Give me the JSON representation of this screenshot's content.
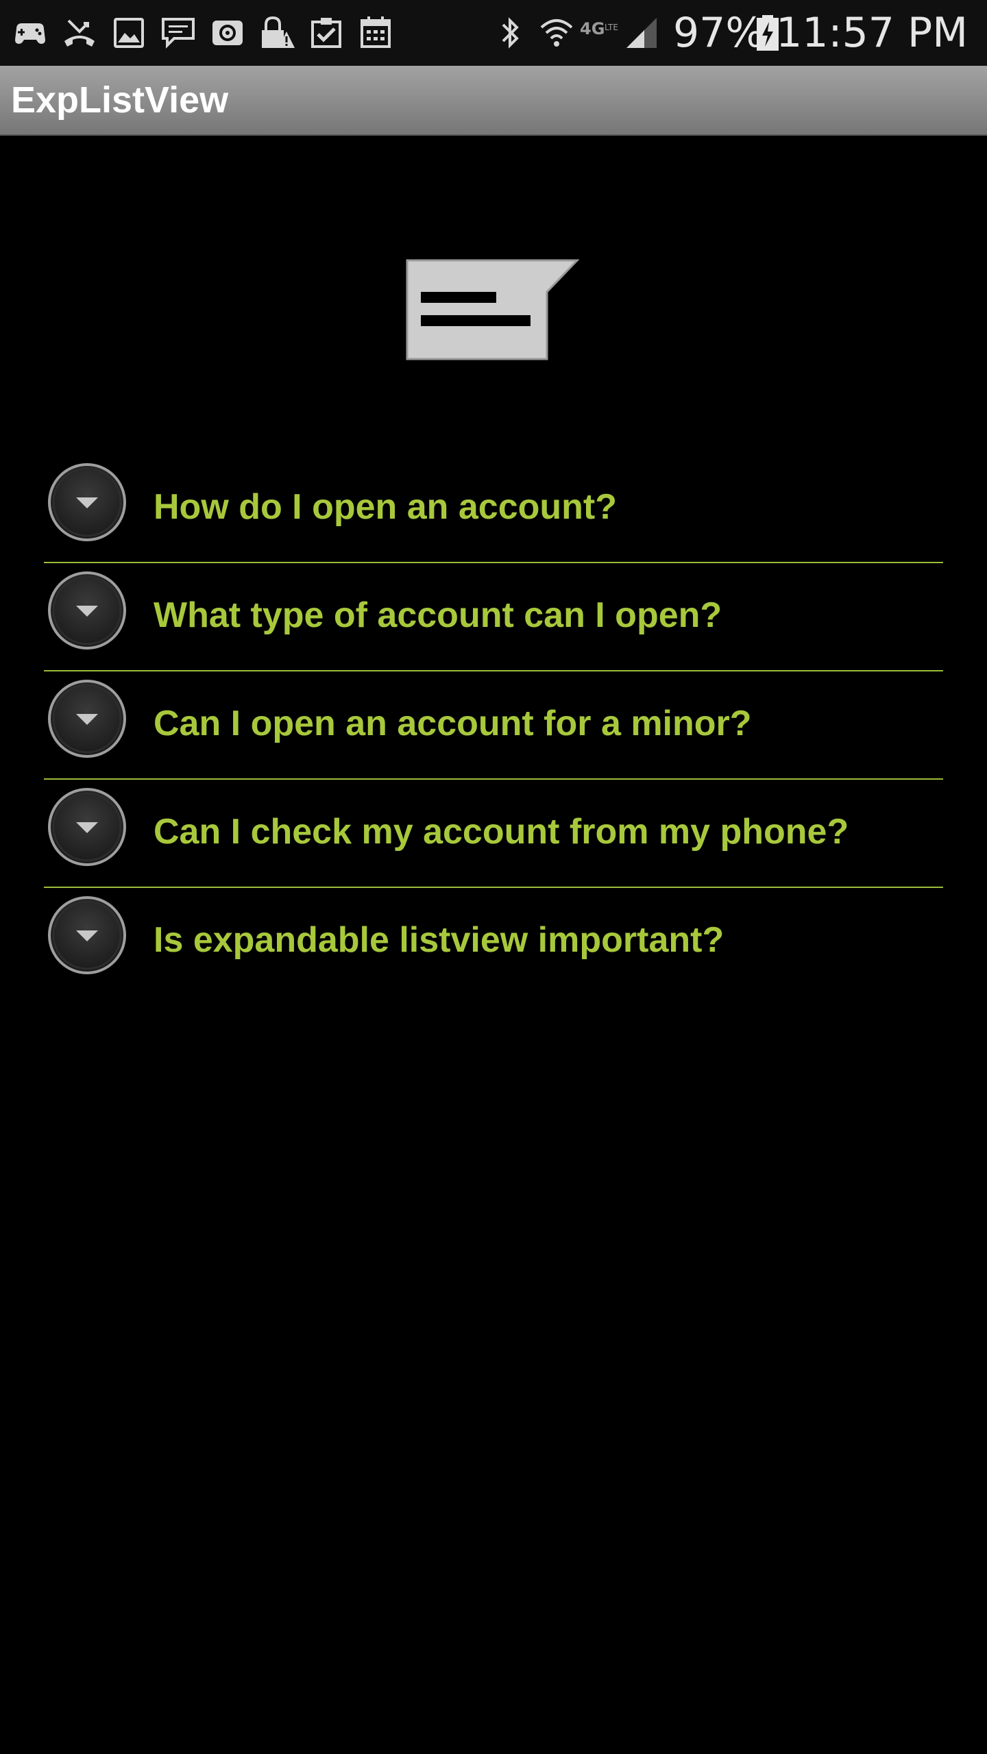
{
  "status_bar": {
    "left_icons": [
      "game-controller-icon",
      "missed-call-icon",
      "gallery-icon",
      "message-icon",
      "email-icon",
      "lock-warning-icon",
      "clipboard-check-icon",
      "calendar-icon"
    ],
    "right_icons": [
      "bluetooth-icon",
      "wifi-icon",
      "lte-icon",
      "signal-icon"
    ],
    "battery_percent": "97%",
    "time": "11:57 PM"
  },
  "action_bar": {
    "title": "ExpListView"
  },
  "header_image": {
    "icon": "message-bubble-icon"
  },
  "faq": {
    "items": [
      {
        "label": "How do I open an account?",
        "expanded": false
      },
      {
        "label": "What type of account can I open?",
        "expanded": false
      },
      {
        "label": "Can I open an account for a minor?",
        "expanded": false
      },
      {
        "label": "Can I check my account from my phone?",
        "expanded": false
      },
      {
        "label": "Is expandable listview important?",
        "expanded": false
      }
    ]
  },
  "colors": {
    "background": "#000000",
    "label_text": "#a8c83c",
    "divider": "#9cbd3a",
    "status_bar": "#101010",
    "action_bar": "#8f8f8f"
  }
}
